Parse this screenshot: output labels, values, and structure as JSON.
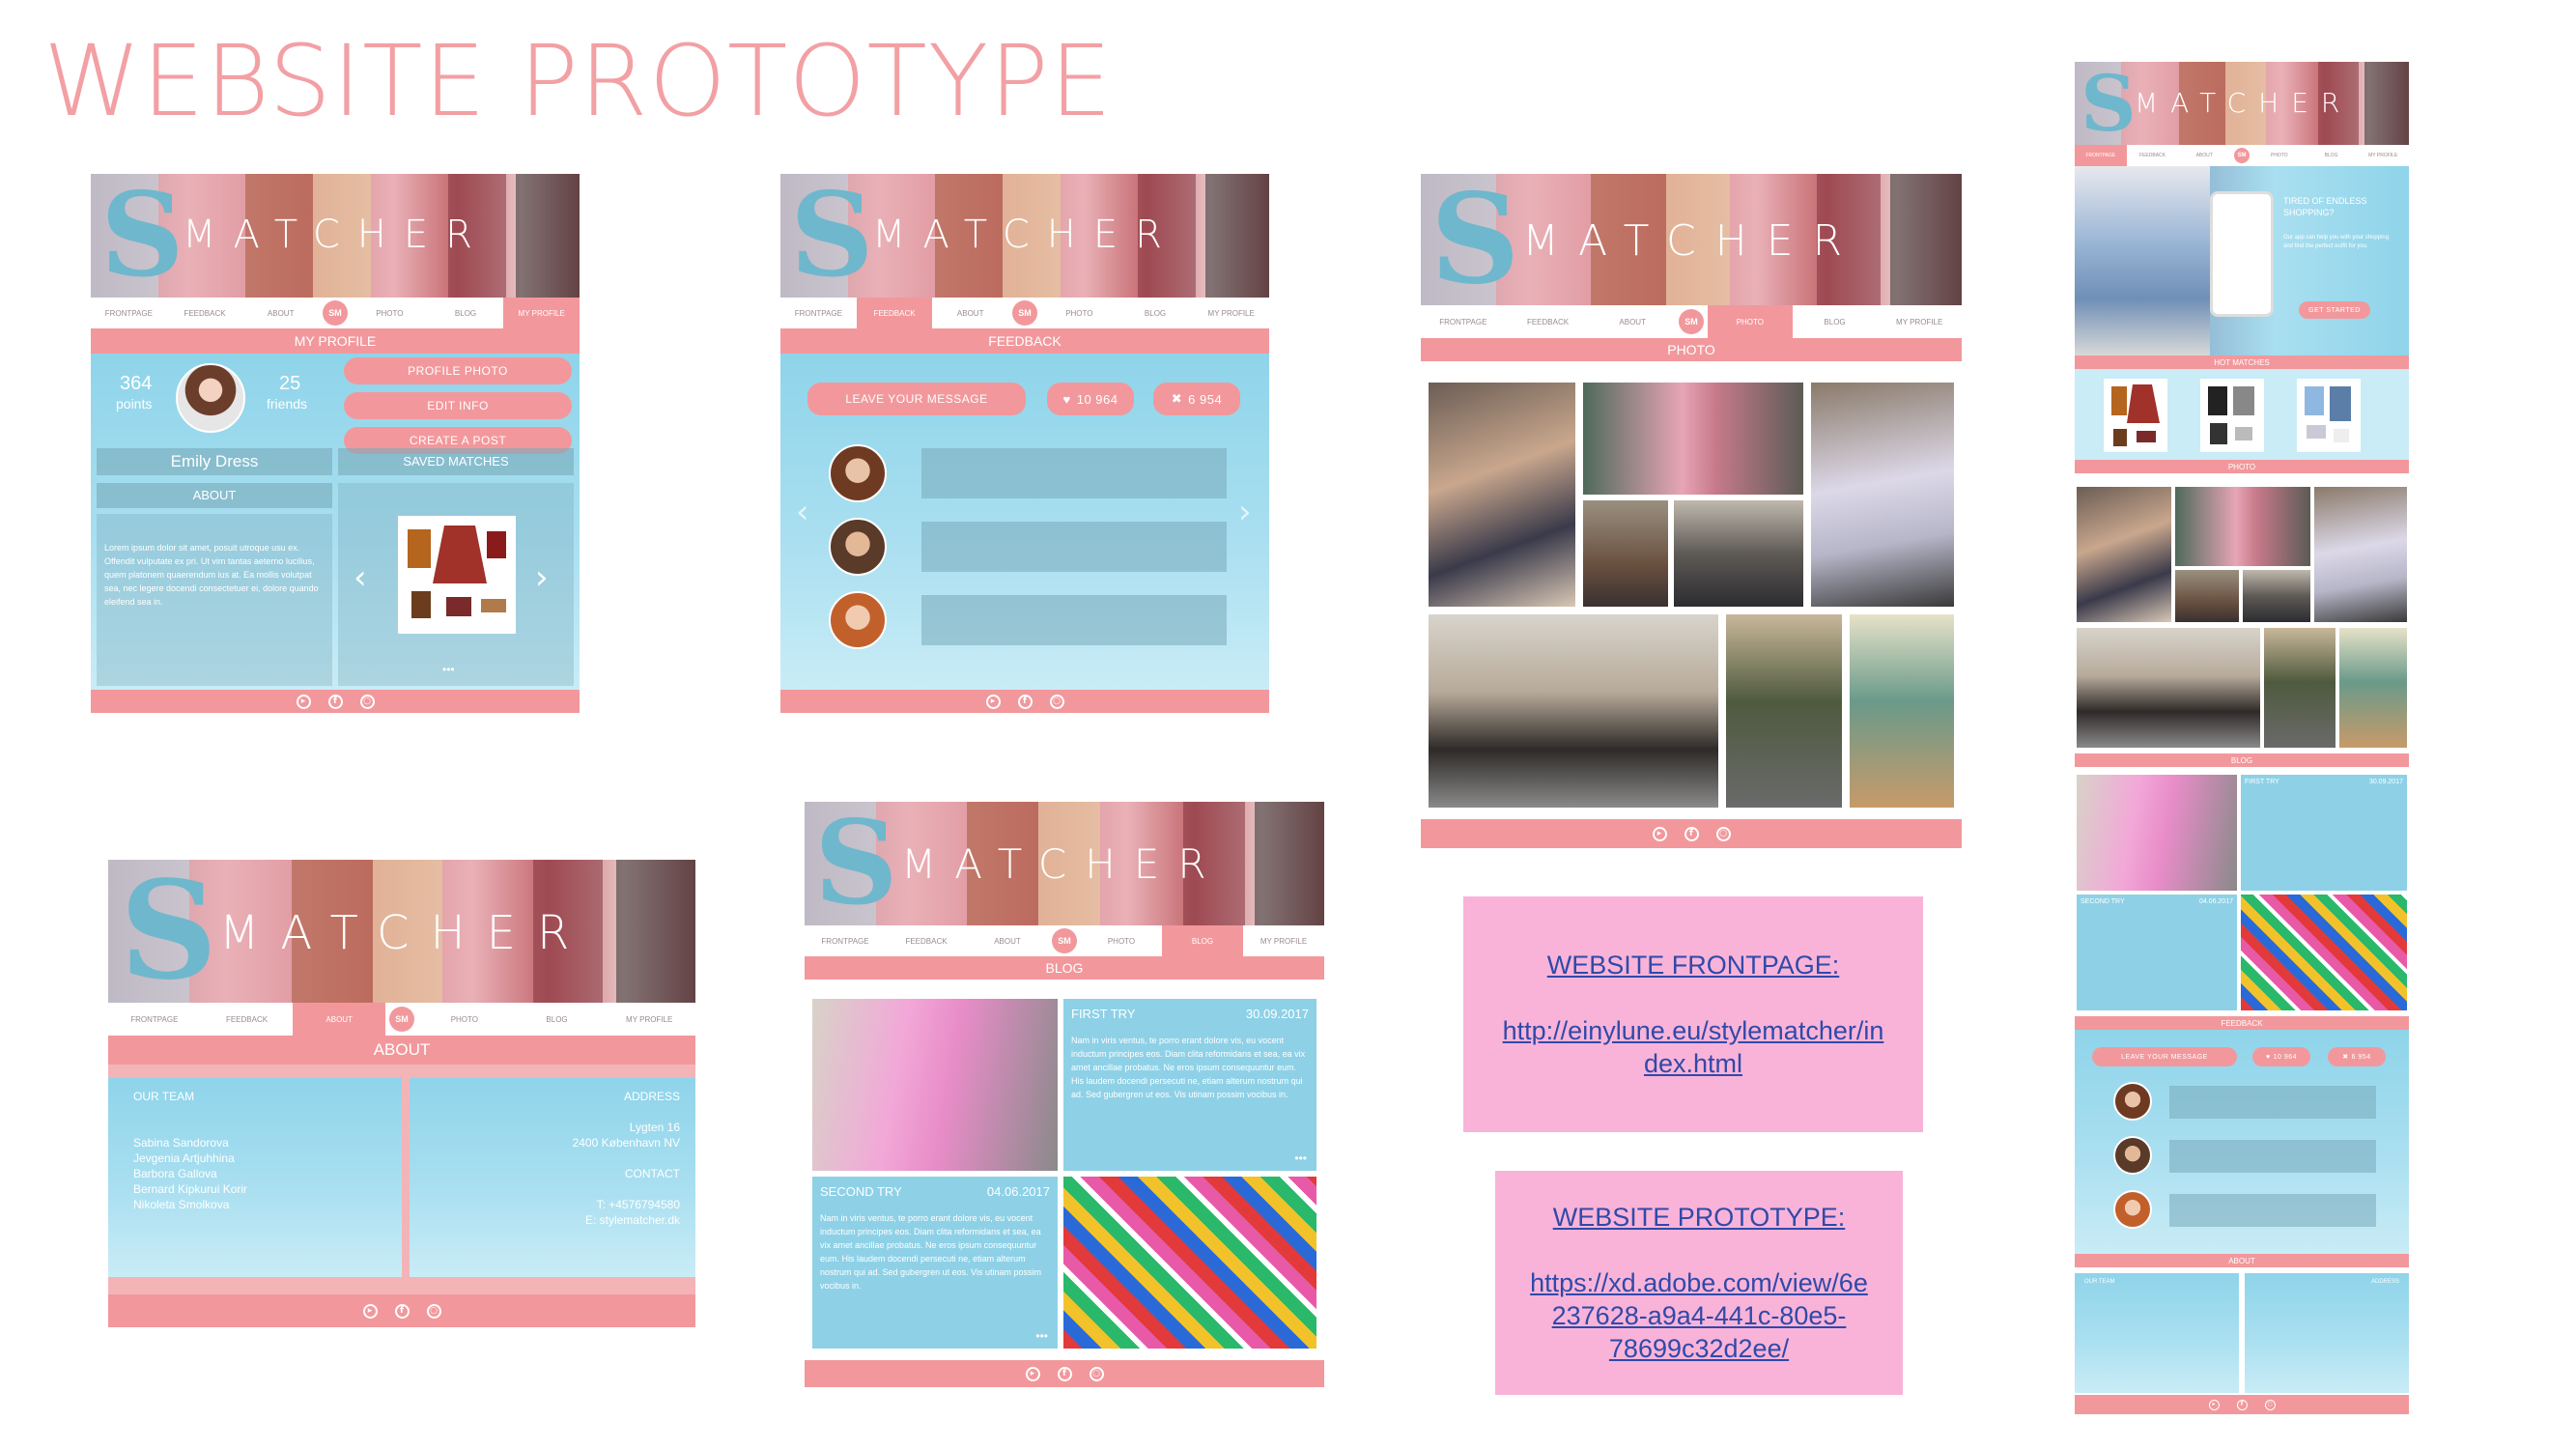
{
  "page_title": "WEBSITE PROTOTYPE",
  "brand": {
    "letters": [
      "S",
      "M",
      "A",
      "T",
      "C",
      "H",
      "E",
      "R"
    ],
    "logo": "SM"
  },
  "nav": [
    "FRONTPAGE",
    "FEEDBACK",
    "ABOUT",
    "PHOTO",
    "BLOG",
    "MY PROFILE"
  ],
  "nav_about": [
    "FRONTPAGE",
    "FEEDBACK",
    "ABOUT",
    "PHOTO",
    "BLOG",
    "MY PROFILE"
  ],
  "footer_icons": [
    "youtube-icon",
    "facebook-icon",
    "instagram-icon"
  ],
  "profile": {
    "section": "MY PROFILE",
    "points_value": "364",
    "points_label": "points",
    "friends_value": "25",
    "friends_label": "friends",
    "btn_photo": "PROFILE PHOTO",
    "btn_edit": "EDIT INFO",
    "btn_post": "CREATE A POST",
    "name": "Emily Dress",
    "saved": "SAVED MATCHES",
    "about": "ABOUT",
    "about_text": "Lorem ipsum dolor sit amet, posuit utroque usu ex. Offendit vulputate ex pri. Ut vim tantas aeterno lucilius, quem platonem quaerendum ius at. Ea mollis volutpat sea, nec legere docendi consectetuer ei, dolore quando eleifend sea in.",
    "dots": "•••"
  },
  "feedback": {
    "section": "FEEDBACK",
    "leave": "LEAVE YOUR MESSAGE",
    "likes": "10 964",
    "dislikes": "6 954"
  },
  "photo": {
    "section": "PHOTO"
  },
  "about": {
    "section": "ABOUT",
    "team_title": "OUR TEAM",
    "team": [
      "Sabina Sandorova",
      "Jevgenia Artjuhhina",
      "Barbora Gallova",
      "Bernard Kipkurui Korir",
      "Nikoleta Smolkova"
    ],
    "address_title": "ADDRESS",
    "address1": "Lygten 16",
    "address2": "2400 København NV",
    "contact_title": "CONTACT",
    "tel": "T: +4576794580",
    "email": "E: stylematcher.dk"
  },
  "blog": {
    "section": "BLOG",
    "post1_title": "FIRST TRY",
    "post1_date": "30.09.2017",
    "post2_title": "SECOND TRY",
    "post2_date": "04.06.2017",
    "body": "Nam in viris ventus, te porro erant dolore vis, eu vocent inductum principes eos. Diam clita reformidans et sea, ea vix amet ancillae probatus. Ne eros ipsum consequuntur eum. His laudem docendi persecuti ne, etiam alterum nostrum qui ad. Sed gubergren ut eos. Vis utinam possim vocibus in.",
    "dots": "•••"
  },
  "frontpage_box": {
    "heading": "WEBSITE FRONTPAGE:",
    "link": "http://einylune.eu/stylematcher/index.html",
    "line1": "http://einylune.eu/stylematcher/in",
    "line2": "dex.html"
  },
  "prototype_box": {
    "heading": "WEBSITE PROTOTYPE:",
    "link": "https://xd.adobe.com/view/6e237628-a9a4-441c-80e5-78699c32d2ee/",
    "line1": "https://xd.adobe.com/view/6e",
    "line2": "237628-a9a4-441c-80e5-",
    "line3": "78699c32d2ee/"
  },
  "long": {
    "hero_title": "TIRED OF ENDLESS SHOPPING?",
    "hero_text": "Our app can help you with your shopping and find the perfect outfit for you.",
    "cta": "GET STARTED",
    "hot": "HOT MATCHES",
    "photo": "PHOTO",
    "blog": "BLOG",
    "feedback": "FEEDBACK",
    "about": "ABOUT"
  },
  "colors": {
    "pink": "#f2989c",
    "sky": "#8fd4ea",
    "title": "#f2a0a4",
    "box": "#f9b3d9",
    "link": "#2f4aa8"
  }
}
